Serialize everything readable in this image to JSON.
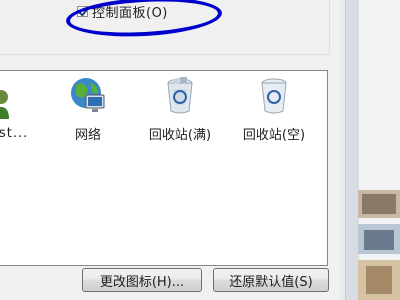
{
  "appearance": {
    "show_control_panel_checkbox_label": "控制面板(O)",
    "show_control_panel_checked": true
  },
  "icons": [
    {
      "label": "st...",
      "icon": "user-icon"
    },
    {
      "label": "网络",
      "icon": "network-icon"
    },
    {
      "label": "回收站(满)",
      "icon": "recycle-bin-full-icon"
    },
    {
      "label": "回收站(空)",
      "icon": "recycle-bin-empty-icon"
    }
  ],
  "buttons": {
    "change_icon": "更改图标(H)...",
    "restore_default": "还原默认值(S)"
  },
  "annotation": {
    "color": "#0000cc"
  }
}
